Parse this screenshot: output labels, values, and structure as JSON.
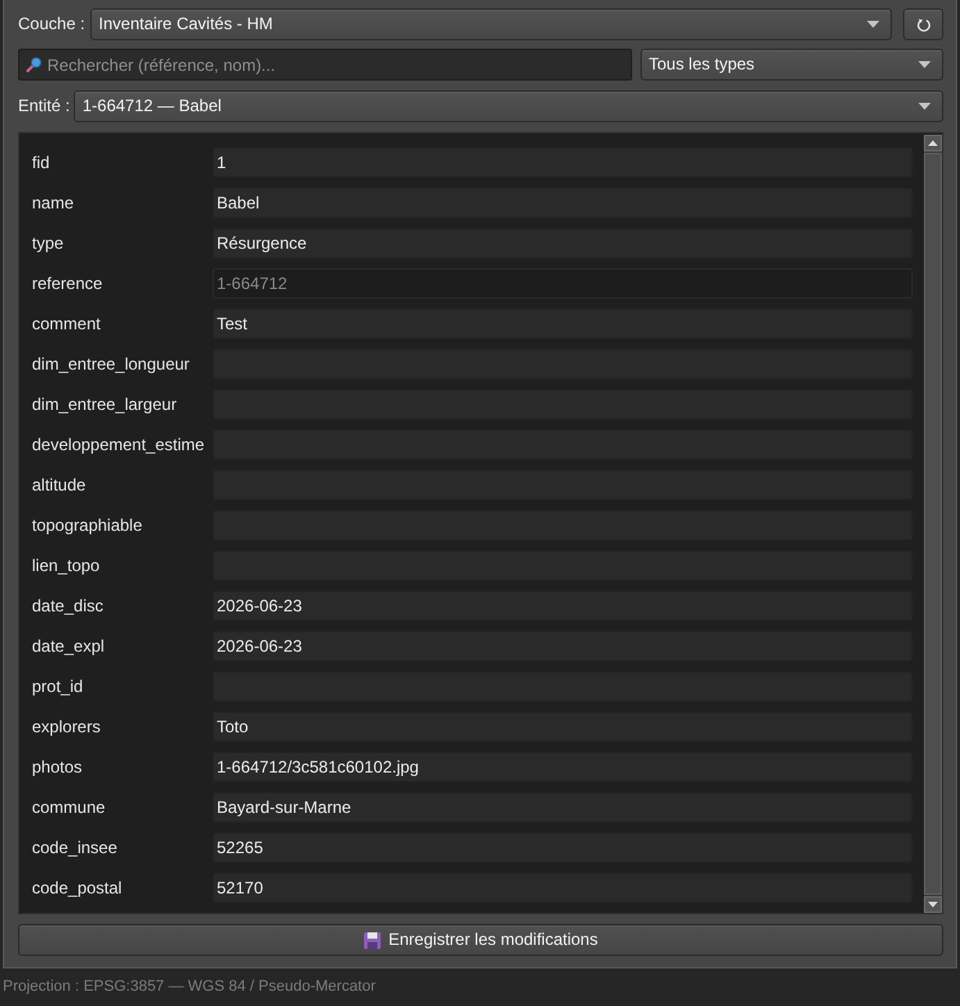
{
  "layer": {
    "label": "Couche :",
    "value": "Inventaire Cavités - HM"
  },
  "search": {
    "placeholder": "Rechercher (référence, nom)..."
  },
  "type_filter": {
    "value": "Tous les types"
  },
  "entity": {
    "label": "Entité :",
    "value": "1-664712 — Babel"
  },
  "fields": [
    {
      "name": "fid",
      "value": "1",
      "readonly": false
    },
    {
      "name": "name",
      "value": "Babel",
      "readonly": false
    },
    {
      "name": "type",
      "value": "Résurgence",
      "readonly": false
    },
    {
      "name": "reference",
      "value": "1-664712",
      "readonly": true
    },
    {
      "name": "comment",
      "value": "Test",
      "readonly": false
    },
    {
      "name": "dim_entree_longueur",
      "readonly": false
    },
    {
      "name": "dim_entree_largeur",
      "readonly": false
    },
    {
      "name": "developpement_estime",
      "readonly": false
    },
    {
      "name": "altitude",
      "readonly": false
    },
    {
      "name": "topographiable",
      "readonly": false
    },
    {
      "name": "lien_topo",
      "readonly": false
    },
    {
      "name": "date_disc",
      "value": "2026-06-23",
      "readonly": false
    },
    {
      "name": "date_expl",
      "value": "2026-06-23",
      "readonly": false
    },
    {
      "name": "prot_id",
      "readonly": false
    },
    {
      "name": "explorers",
      "value": "Toto",
      "readonly": false
    },
    {
      "name": "photos",
      "value": "1-664712/3c581c60102.jpg",
      "readonly": false
    },
    {
      "name": "commune",
      "value": "Bayard-sur-Marne",
      "readonly": false
    },
    {
      "name": "code_insee",
      "value": "52265",
      "readonly": false
    },
    {
      "name": "code_postal",
      "value": "52170",
      "readonly": false
    }
  ],
  "save_button": {
    "label": "Enregistrer les modifications"
  },
  "status_bar": {
    "text": "Projection : EPSG:3857 — WGS 84 / Pseudo-Mercator"
  }
}
